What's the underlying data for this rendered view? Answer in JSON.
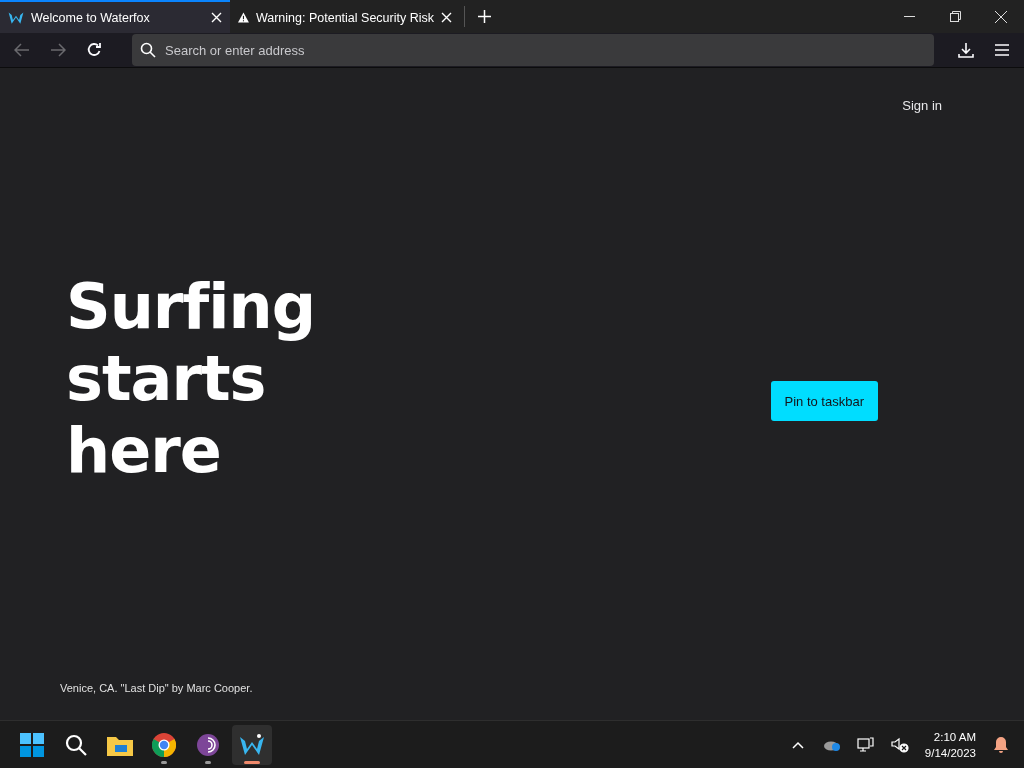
{
  "tabs": [
    {
      "title": "Welcome to Waterfox",
      "selected": true
    },
    {
      "title": "Warning: Potential Security Risk",
      "selected": false
    }
  ],
  "address_bar": {
    "placeholder": "Search or enter address"
  },
  "page": {
    "sign_in": "Sign in",
    "headline": [
      "Surfing",
      "starts",
      "here"
    ],
    "button": "Pin to taskbar",
    "caption": "Venice, CA. \"Last Dip\" by Marc Cooper."
  },
  "taskbar": {
    "apps": [
      {
        "kind": "start",
        "running": false,
        "active": false
      },
      {
        "kind": "search",
        "running": false,
        "active": false
      },
      {
        "kind": "files",
        "running": false,
        "active": false
      },
      {
        "kind": "chrome",
        "running": true,
        "active": false
      },
      {
        "kind": "tor",
        "running": true,
        "active": false
      },
      {
        "kind": "waterfox",
        "running": true,
        "active": true
      }
    ],
    "time": "2:10 AM",
    "date": "9/14/2023"
  }
}
